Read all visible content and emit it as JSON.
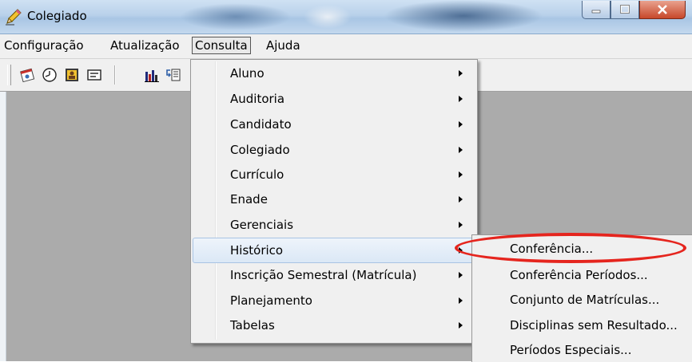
{
  "window": {
    "title": "Colegiado"
  },
  "menubar": {
    "items": [
      "Configuração",
      "Atualização",
      "Consulta",
      "Ajuda"
    ],
    "open_item": "Consulta"
  },
  "toolbar": {
    "icons": [
      "calendar-icon",
      "clock-icon",
      "contact-card-icon",
      "id-card-icon",
      "bar-chart-icon",
      "list-transfer-icon"
    ]
  },
  "consulta_menu": {
    "items": [
      {
        "label": "Aluno",
        "has_submenu": true
      },
      {
        "label": "Auditoria",
        "has_submenu": true
      },
      {
        "label": "Candidato",
        "has_submenu": true
      },
      {
        "label": "Colegiado",
        "has_submenu": true
      },
      {
        "label": "Currículo",
        "has_submenu": true
      },
      {
        "label": "Enade",
        "has_submenu": true
      },
      {
        "label": "Gerenciais",
        "has_submenu": true
      },
      {
        "label": "Histórico",
        "has_submenu": true
      },
      {
        "label": "Inscrição Semestral (Matrícula)",
        "has_submenu": true
      },
      {
        "label": "Planejamento",
        "has_submenu": true
      },
      {
        "label": "Tabelas",
        "has_submenu": true
      }
    ],
    "highlighted": "Histórico"
  },
  "historico_submenu": {
    "items": [
      "Conferência...",
      "Conferência Períodos...",
      "Conjunto de Matrículas...",
      "Disciplinas sem Resultado...",
      "Períodos Especiais..."
    ],
    "circled": "Conferência..."
  },
  "colors": {
    "highlight_ring": "#e5251e",
    "client_bg": "#ababab",
    "menu_bg": "#f0f0f0"
  }
}
